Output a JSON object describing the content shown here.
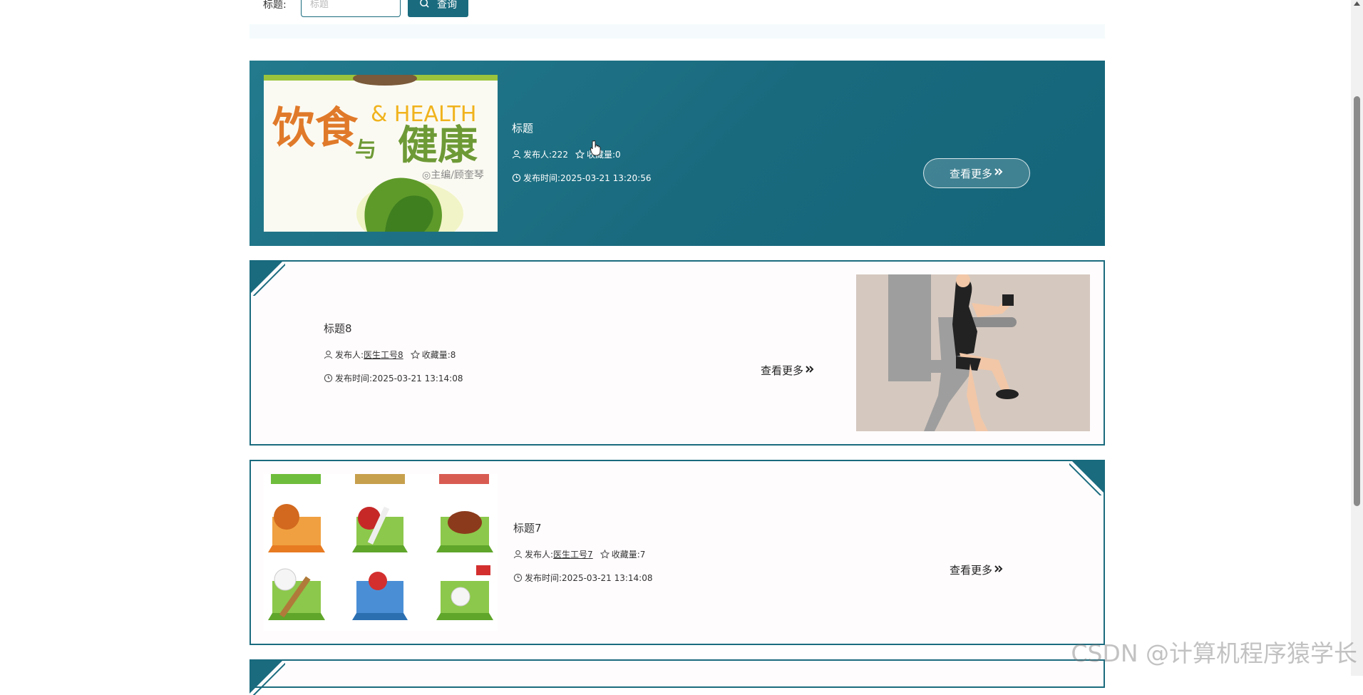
{
  "search": {
    "label": "标题:",
    "placeholder": "标题",
    "button_label": "查询"
  },
  "posts": [
    {
      "title": "标题",
      "publisher_label": "发布人:",
      "publisher": "222",
      "favorites_label": "收藏量:",
      "favorites": "0",
      "time_label": "发布时间:",
      "time": "2025-03-21 13:20:56",
      "more_label": "查看更多",
      "image": "book cover 饮食与健康 & HEALTH",
      "cover_text": {
        "line1": "饮食",
        "line2": "与",
        "line3": "健康",
        "health": "& HEALTH",
        "editor": "◎主编/顾奎琴"
      }
    },
    {
      "title": "标题8",
      "publisher_label": "发布人:",
      "publisher": "医生工号8",
      "favorites_label": "收藏量:",
      "favorites": "8",
      "time_label": "发布时间:",
      "time": "2025-03-21 13:14:08",
      "more_label": "查看更多",
      "image": "woman exercising on fitness machine"
    },
    {
      "title": "标题7",
      "publisher_label": "发布人:",
      "publisher": "医生工号7",
      "favorites_label": "收藏量:",
      "favorites": "7",
      "time_label": "发布时间:",
      "time": "2025-03-21 13:14:08",
      "more_label": "查看更多",
      "image": "sports icons grid"
    }
  ],
  "watermark": "CSDN @计算机程序猿学长",
  "colors": {
    "accent": "#1a6b7e",
    "card_bg": "#fffcfe",
    "strip": "#f5fbfc"
  }
}
